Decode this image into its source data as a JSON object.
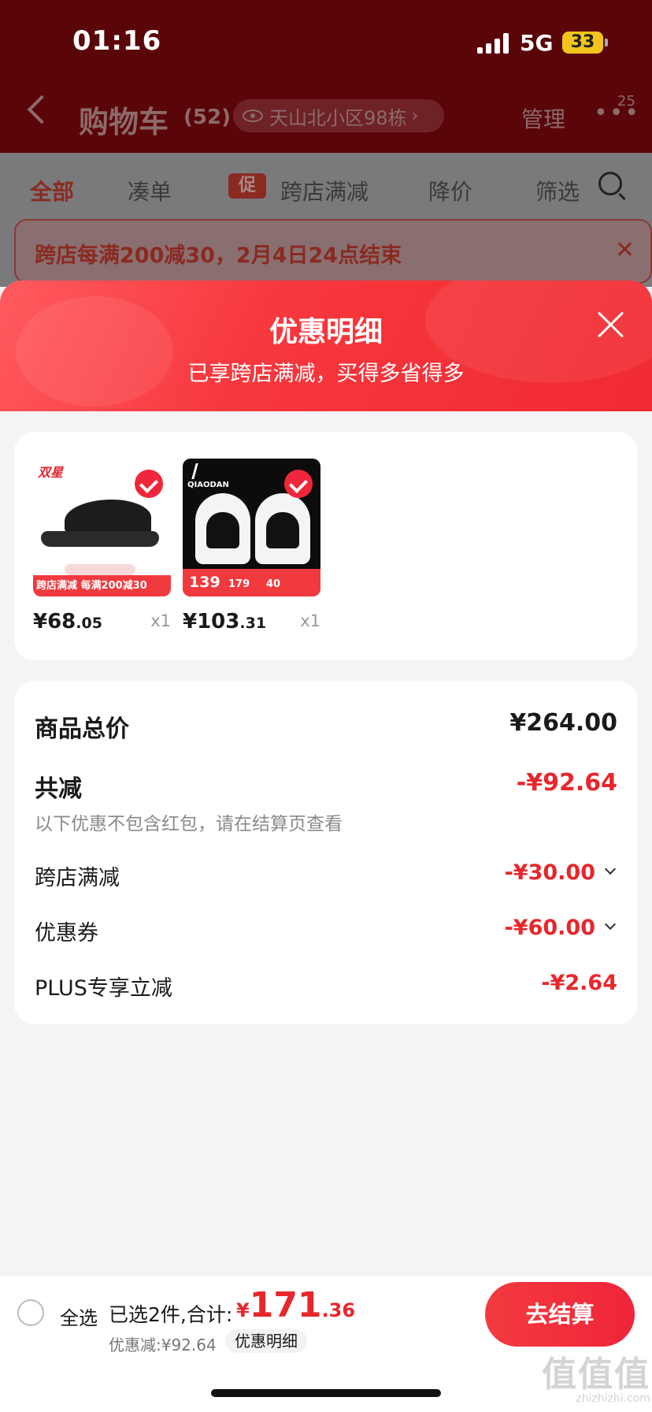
{
  "status_bar": {
    "time": "01:16",
    "network": "5G",
    "battery": "33"
  },
  "nav": {
    "title": "购物车",
    "count": "(52)",
    "address": "天山北小区98栋",
    "manage": "管理",
    "more": "•••",
    "more_badge": "25"
  },
  "tabs": [
    {
      "label": "全部",
      "active": true
    },
    {
      "label": "凑单",
      "active": false
    },
    {
      "label": "跨店满减",
      "active": false,
      "tag": "促"
    },
    {
      "label": "降价",
      "active": false
    },
    {
      "label": "筛选",
      "active": false
    }
  ],
  "notice": {
    "text": "跨店每满200减30，2月4日24点结束",
    "close": "✕"
  },
  "sheet": {
    "title": "优惠明细",
    "subtitle": "已享跨店满减，买得多省得多",
    "products": [
      {
        "brand": "双星",
        "promo_strip": "跨店满减  每满200减30",
        "price_int": "¥68",
        "price_dec": ".05",
        "qty": "x1",
        "checked": true
      },
      {
        "brand": "QIAODAN",
        "promo_price_1": "139",
        "promo_price_2": "179",
        "promo_price_3": "40",
        "price_int": "¥103",
        "price_dec": ".31",
        "qty": "x1",
        "checked": true
      }
    ],
    "summary": {
      "total_label": "商品总价",
      "total_value": "¥264.00",
      "reduce_label": "共减",
      "reduce_value": "-¥92.64",
      "note": "以下优惠不包含红包，请在结算页查看",
      "items": [
        {
          "label": "跨店满减",
          "value": "-¥30.00",
          "expandable": true
        },
        {
          "label": "优惠券",
          "value": "-¥60.00",
          "expandable": true
        },
        {
          "label": "PLUS专享立减",
          "value": "-¥2.64",
          "expandable": false
        }
      ]
    }
  },
  "bottom": {
    "select_all": "全选",
    "selected_text": "已选2件,合计:",
    "total_currency": "¥",
    "total_int": "171",
    "total_dec": ".36",
    "discount_text": "优惠减:¥92.64",
    "detail_chip": "优惠明细",
    "checkout": "去结算",
    "watermark": "值值值",
    "watermark_sub": "zhizhizhi.com"
  },
  "colors": {
    "accent_red": "#e8262c",
    "header_dark": "#5a0508",
    "sheet_red": "#f02a30"
  },
  "icons": [
    "back-chevron-icon",
    "eye-icon",
    "search-icon",
    "close-icon",
    "check-icon",
    "chevron-down-icon"
  ]
}
